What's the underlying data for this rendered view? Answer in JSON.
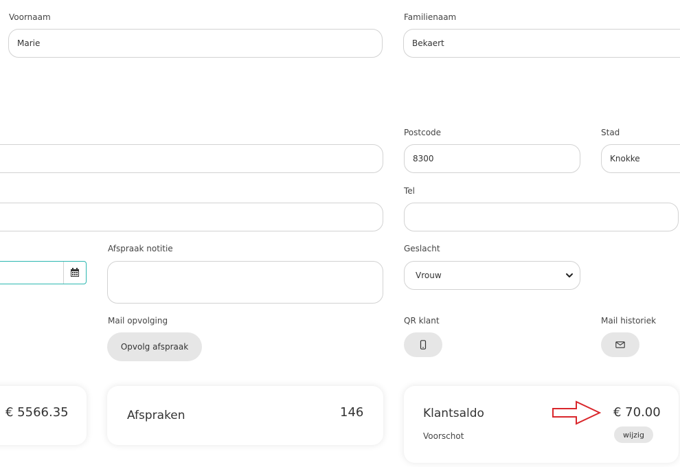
{
  "fields": {
    "voornaam": {
      "label": "Voornaam",
      "value": "Marie"
    },
    "familienaam": {
      "label": "Familienaam",
      "value": "Bekaert"
    },
    "adres": {
      "value": ""
    },
    "postcode": {
      "label": "Postcode",
      "value": "8300"
    },
    "stad": {
      "label": "Stad",
      "value": "Knokke"
    },
    "email": {
      "value": ""
    },
    "tel": {
      "label": "Tel",
      "value": ""
    },
    "datum": {
      "value": ""
    },
    "afspraak_notitie": {
      "label": "Afspraak notitie",
      "value": ""
    },
    "geslacht": {
      "label": "Geslacht",
      "value": "Vrouw"
    }
  },
  "actions": {
    "mail_opvolging": {
      "label": "Mail opvolging",
      "button": "Opvolg afspraak"
    },
    "qr_klant": {
      "label": "QR klant",
      "icon": "phone-icon"
    },
    "mail_historiek": {
      "label": "Mail historiek",
      "icon": "mail-icon"
    }
  },
  "cards": {
    "omzet": {
      "value": "€ 5566.35"
    },
    "afspraken": {
      "title": "Afspraken",
      "value": "146"
    },
    "klantsaldo": {
      "title": "Klantsaldo",
      "value": "€ 70.00",
      "subtitle": "Voorschot",
      "button": "wijzig"
    }
  },
  "colors": {
    "accent": "#2bb7b0",
    "arrow": "#d9262b"
  }
}
